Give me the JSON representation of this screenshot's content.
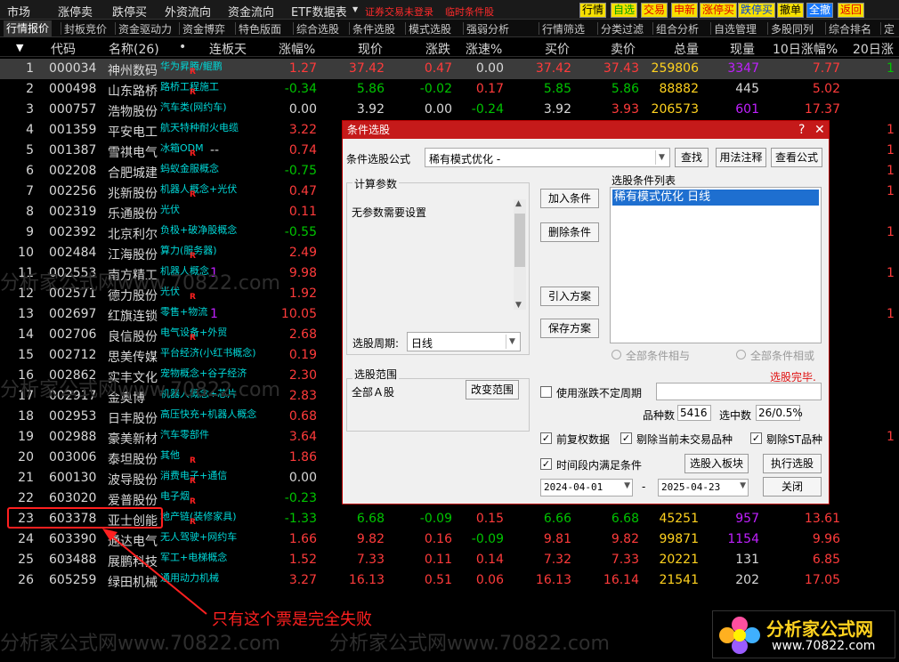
{
  "menu": [
    "市场",
    "涨停卖",
    "跌停买",
    "外资流向",
    "资金流向",
    "ETF数据表"
  ],
  "top_red_text": [
    "证券交易未登录",
    "临时条件股"
  ],
  "top_buttons": [
    "行情",
    "自选",
    "交易",
    "申新",
    "涨停买",
    "跌停买",
    "撤单",
    "全撤",
    "返回"
  ],
  "tabs": [
    "行情报价",
    "封板竞价",
    "资金驱动力",
    "资金博弈",
    "特色版面",
    "综合选股",
    "条件选股",
    "模式选股",
    "强弱分析",
    "行情筛选",
    "分类过滤",
    "组合分析",
    "自选管理",
    "多股同列",
    "综合排名",
    "定"
  ],
  "headers": {
    "sort": "▼",
    "code": "代码",
    "name": "名称(26)",
    "dot": "•",
    "lianban": "连板天",
    "zhangfu": "涨幅%",
    "xianjia": "现价",
    "zhangdie": "涨跌",
    "zhangsu": "涨速%",
    "mairu": "买价",
    "maichu": "卖价",
    "zongliang": "总量",
    "xianliang": "现量",
    "tenday": "10日涨幅%",
    "twentyday": "20日涨"
  },
  "rows": [
    {
      "idx": "1",
      "code": "000034",
      "name": "神州数码",
      "concept": "华为昇腾/鲲鹏",
      "r": "R",
      "lb": "",
      "chg": "1.27",
      "price": "37.42",
      "diff": "0.47",
      "speed": "0.00",
      "bid": "37.42",
      "ask": "37.43",
      "vol": "259806",
      "cur": "3347",
      "d10": "7.77",
      "d20": "-1",
      "chg_c": "red",
      "price_c": "red",
      "diff_c": "red",
      "speed_c": "white",
      "bid_c": "red",
      "ask_c": "red",
      "cur_c": "purple",
      "d10_c": "red",
      "d20_c": "green",
      "sel": true
    },
    {
      "idx": "2",
      "code": "000498",
      "name": "山东路桥",
      "concept": "路桥工程施工",
      "r": "R",
      "lb": "",
      "chg": "-0.34",
      "price": "5.86",
      "diff": "-0.02",
      "speed": "0.17",
      "bid": "5.85",
      "ask": "5.86",
      "vol": "88882",
      "cur": "445",
      "d10": "5.02",
      "d20": "",
      "chg_c": "green",
      "price_c": "green",
      "diff_c": "green",
      "speed_c": "red",
      "bid_c": "green",
      "ask_c": "green",
      "cur_c": "white",
      "d10_c": "red",
      "d20_c": "red"
    },
    {
      "idx": "3",
      "code": "000757",
      "name": "浩物股份",
      "concept": "汽车类(网约车)",
      "r": "",
      "lb": "",
      "chg": "0.00",
      "price": "3.92",
      "diff": "0.00",
      "speed": "-0.24",
      "bid": "3.92",
      "ask": "3.93",
      "vol": "206573",
      "cur": "601",
      "d10": "17.37",
      "d20": "",
      "chg_c": "white",
      "price_c": "white",
      "diff_c": "white",
      "speed_c": "green",
      "bid_c": "white",
      "ask_c": "red",
      "cur_c": "purple",
      "d10_c": "red",
      "d20_c": "red"
    },
    {
      "idx": "4",
      "code": "001359",
      "name": "平安电工",
      "concept": "航天特种耐火电缆",
      "r": "",
      "lb": "",
      "chg": "3.22",
      "price": "",
      "diff": "",
      "speed": "",
      "bid": "",
      "ask": "",
      "vol": "",
      "cur": "",
      "d10": "",
      "d20": "",
      "chg_c": "red"
    },
    {
      "idx": "5",
      "code": "001387",
      "name": "雪祺电气",
      "concept": "冰箱ODM",
      "r": "R",
      "lb": "--",
      "chg": "0.74",
      "price": "",
      "diff": "",
      "speed": "",
      "bid": "",
      "ask": "",
      "vol": "",
      "cur": "",
      "d10": "",
      "d20": "",
      "chg_c": "red"
    },
    {
      "idx": "6",
      "code": "002208",
      "name": "合肥城建",
      "concept": "蚂蚁金服概念",
      "r": "",
      "lb": "",
      "chg": "-0.75",
      "price": "",
      "diff": "",
      "speed": "",
      "bid": "",
      "ask": "",
      "vol": "",
      "cur": "",
      "d10": "",
      "d20": "",
      "chg_c": "green"
    },
    {
      "idx": "7",
      "code": "002256",
      "name": "兆新股份",
      "concept": "机器人概念+光伏",
      "r": "R",
      "lb": "",
      "chg": "0.47",
      "price": "",
      "diff": "",
      "speed": "",
      "bid": "",
      "ask": "",
      "vol": "",
      "cur": "",
      "d10": "",
      "d20": "",
      "chg_c": "red"
    },
    {
      "idx": "8",
      "code": "002319",
      "name": "乐通股份",
      "concept": "光伏",
      "r": "",
      "lb": "",
      "chg": "0.11",
      "price": "",
      "diff": "",
      "speed": "",
      "bid": "",
      "ask": "",
      "vol": "",
      "cur": "",
      "d10": "",
      "d20": "",
      "chg_c": "red"
    },
    {
      "idx": "9",
      "code": "002392",
      "name": "北京利尔",
      "concept": "负极+破净股概念",
      "r": "",
      "lb": "",
      "chg": "-0.55",
      "price": "",
      "diff": "",
      "speed": "",
      "bid": "",
      "ask": "",
      "vol": "",
      "cur": "",
      "d10": "",
      "d20": "",
      "chg_c": "green"
    },
    {
      "idx": "10",
      "code": "002484",
      "name": "江海股份",
      "concept": "算力(服务器)",
      "r": "R",
      "lb": "",
      "chg": "2.49",
      "price": "",
      "diff": "",
      "speed": "",
      "bid": "",
      "ask": "",
      "vol": "",
      "cur": "",
      "d10": "",
      "d20": "",
      "chg_c": "red"
    },
    {
      "idx": "11",
      "code": "002553",
      "name": "南方精工",
      "concept": "机器人概念",
      "r": "",
      "lb": "1",
      "chg": "9.98",
      "price": "",
      "diff": "",
      "speed": "",
      "bid": "",
      "ask": "",
      "vol": "",
      "cur": "",
      "d10": "",
      "d20": "",
      "chg_c": "red"
    },
    {
      "idx": "12",
      "code": "002571",
      "name": "德力股份",
      "concept": "光伏",
      "r": "R",
      "lb": "",
      "chg": "1.92",
      "price": "",
      "diff": "",
      "speed": "",
      "bid": "",
      "ask": "",
      "vol": "",
      "cur": "",
      "d10": "",
      "d20": "",
      "chg_c": "red"
    },
    {
      "idx": "13",
      "code": "002697",
      "name": "红旗连锁",
      "concept": "零售+物流",
      "r": "",
      "lb": "1",
      "chg": "10.05",
      "price": "",
      "diff": "",
      "speed": "",
      "bid": "",
      "ask": "",
      "vol": "",
      "cur": "",
      "d10": "",
      "d20": "",
      "chg_c": "red"
    },
    {
      "idx": "14",
      "code": "002706",
      "name": "良信股份",
      "concept": "电气设备+外贸",
      "r": "R",
      "lb": "",
      "chg": "2.68",
      "price": "",
      "diff": "",
      "speed": "",
      "bid": "",
      "ask": "",
      "vol": "",
      "cur": "",
      "d10": "",
      "d20": "",
      "chg_c": "red"
    },
    {
      "idx": "15",
      "code": "002712",
      "name": "思美传媒",
      "concept": "平台经济(小红书概念)",
      "r": "",
      "lb": "",
      "chg": "0.19",
      "price": "",
      "diff": "",
      "speed": "",
      "bid": "",
      "ask": "",
      "vol": "",
      "cur": "",
      "d10": "",
      "d20": "",
      "chg_c": "red"
    },
    {
      "idx": "16",
      "code": "002862",
      "name": "实丰文化",
      "concept": "宠物概念+谷子经济",
      "r": "",
      "lb": "",
      "chg": "2.30",
      "price": "",
      "diff": "",
      "speed": "",
      "bid": "",
      "ask": "",
      "vol": "",
      "cur": "",
      "d10": "",
      "d20": "",
      "chg_c": "red"
    },
    {
      "idx": "17",
      "code": "002917",
      "name": "金奥博",
      "concept": "机器人概念+芯片",
      "r": "",
      "lb": "",
      "chg": "2.83",
      "price": "",
      "diff": "",
      "speed": "",
      "bid": "",
      "ask": "",
      "vol": "",
      "cur": "",
      "d10": "",
      "d20": "",
      "chg_c": "red"
    },
    {
      "idx": "18",
      "code": "002953",
      "name": "日丰股份",
      "concept": "高压快充+机器人概念",
      "r": "",
      "lb": "",
      "chg": "0.68",
      "price": "",
      "diff": "",
      "speed": "",
      "bid": "",
      "ask": "",
      "vol": "",
      "cur": "",
      "d10": "",
      "d20": "",
      "chg_c": "red"
    },
    {
      "idx": "19",
      "code": "002988",
      "name": "豪美新材",
      "concept": "汽车零部件",
      "r": "",
      "lb": "",
      "chg": "3.64",
      "price": "",
      "diff": "",
      "speed": "",
      "bid": "",
      "ask": "",
      "vol": "",
      "cur": "",
      "d10": "",
      "d20": "",
      "chg_c": "red"
    },
    {
      "idx": "20",
      "code": "003006",
      "name": "泰坦股份",
      "concept": "其他",
      "r": "R",
      "lb": "",
      "chg": "1.86",
      "price": "",
      "diff": "",
      "speed": "",
      "bid": "",
      "ask": "",
      "vol": "",
      "cur": "",
      "d10": "",
      "d20": "",
      "chg_c": "red"
    },
    {
      "idx": "21",
      "code": "600130",
      "name": "波导股份",
      "concept": "消费电子+通信",
      "r": "R",
      "lb": "",
      "chg": "0.00",
      "price": "",
      "diff": "",
      "speed": "",
      "bid": "",
      "ask": "",
      "vol": "",
      "cur": "",
      "d10": "",
      "d20": "",
      "chg_c": "white"
    },
    {
      "idx": "22",
      "code": "603020",
      "name": "爱普股份",
      "concept": "电子烟",
      "r": "R",
      "lb": "",
      "chg": "-0.23",
      "price": "",
      "diff": "",
      "speed": "",
      "bid": "",
      "ask": "",
      "vol": "",
      "cur": "",
      "d10": "",
      "d20": "",
      "chg_c": "green"
    },
    {
      "idx": "23",
      "code": "603378",
      "name": "亚士创能",
      "concept": "地产链(装修家具)",
      "r": "R",
      "lb": "",
      "chg": "-1.33",
      "price": "6.68",
      "diff": "-0.09",
      "speed": "0.15",
      "bid": "6.66",
      "ask": "6.68",
      "vol": "45251",
      "cur": "957",
      "d10": "13.61",
      "d20": "",
      "chg_c": "green",
      "price_c": "green",
      "diff_c": "green",
      "speed_c": "red",
      "bid_c": "green",
      "ask_c": "green",
      "cur_c": "purple",
      "d10_c": "red",
      "d20_c": "red"
    },
    {
      "idx": "24",
      "code": "603390",
      "name": "通达电气",
      "concept": "无人驾驶+网约车",
      "r": "",
      "lb": "",
      "chg": "1.66",
      "price": "9.82",
      "diff": "0.16",
      "speed": "-0.09",
      "bid": "9.81",
      "ask": "9.82",
      "vol": "99871",
      "cur": "1154",
      "d10": "9.96",
      "d20": "",
      "chg_c": "red",
      "price_c": "red",
      "diff_c": "red",
      "speed_c": "green",
      "bid_c": "red",
      "ask_c": "red",
      "cur_c": "purple",
      "d10_c": "red",
      "d20_c": "red"
    },
    {
      "idx": "25",
      "code": "603488",
      "name": "展鹏科技",
      "concept": "军工+电梯概念",
      "r": "",
      "lb": "",
      "chg": "1.52",
      "price": "7.33",
      "diff": "0.11",
      "speed": "0.14",
      "bid": "7.32",
      "ask": "7.33",
      "vol": "20221",
      "cur": "131",
      "d10": "6.85",
      "d20": "",
      "chg_c": "red",
      "price_c": "red",
      "diff_c": "red",
      "speed_c": "red",
      "bid_c": "red",
      "ask_c": "red",
      "cur_c": "white",
      "d10_c": "red",
      "d20_c": "red"
    },
    {
      "idx": "26",
      "code": "605259",
      "name": "绿田机械",
      "concept": "通用动力机械",
      "r": "",
      "lb": "",
      "chg": "3.27",
      "price": "16.13",
      "diff": "0.51",
      "speed": "0.06",
      "bid": "16.13",
      "ask": "16.14",
      "vol": "21541",
      "cur": "202",
      "d10": "17.05",
      "d20": "",
      "chg_c": "red",
      "price_c": "red",
      "diff_c": "red",
      "speed_c": "red",
      "bid_c": "red",
      "ask_c": "red",
      "cur_c": "white",
      "d10_c": "red",
      "d20_c": "red"
    }
  ],
  "right_edge_vals": [
    "1",
    "",
    "",
    "1",
    "1",
    "1",
    "1",
    "",
    "1",
    "",
    "1",
    "",
    "1",
    "",
    "",
    "",
    "",
    "",
    "1",
    "",
    "",
    "",
    "",
    "",
    "",
    ""
  ],
  "dialog": {
    "title": "条件选股",
    "formula_label": "条件选股公式",
    "formula_value": "稀有模式优化 -",
    "btn_find": "查找",
    "btn_usage": "用法注释",
    "btn_view": "查看公式",
    "params_group": "计算参数",
    "params_text": "无参数需要设置",
    "btn_add": "加入条件",
    "btn_delete": "删除条件",
    "btn_import": "引入方案",
    "btn_save": "保存方案",
    "list_label": "选股条件列表",
    "list_item": "稀有模式优化 日线",
    "period_label": "选股周期:",
    "period_value": "日线",
    "radio_and": "全部条件相与",
    "radio_or": "全部条件相或",
    "done_text": "选股完毕.",
    "range_group": "选股范围",
    "range_value": "全部Ａ股",
    "btn_range": "改变范围",
    "chk_indefinite": "使用涨跌不定周期",
    "count_label": "品种数",
    "count_value": "5416",
    "selected_label": "选中数",
    "selected_value": "26/0.5%",
    "chk_prior": "前复权数据",
    "chk_remove_untraded": "剔除当前未交易品种",
    "chk_remove_st": "剔除ST品种",
    "chk_period": "时间段内满足条件",
    "btn_into_block": "选股入板块",
    "btn_execute": "执行选股",
    "date_from": "2024-04-01",
    "date_sep": "-",
    "date_to": "2025-04-23",
    "btn_close": "关闭"
  },
  "annotation": "只有这个票是完全失败",
  "watermark": "分析家公式网www.70822.com",
  "logo": {
    "title": "分析家公式网",
    "url": "www.70822.com"
  },
  "colors": {
    "red": "#ff3b3b",
    "green": "#00c400",
    "yellow": "#ffd21f",
    "purple": "#c020ff",
    "cyan": "#00d8d8",
    "title_red": "#c51a1a"
  }
}
